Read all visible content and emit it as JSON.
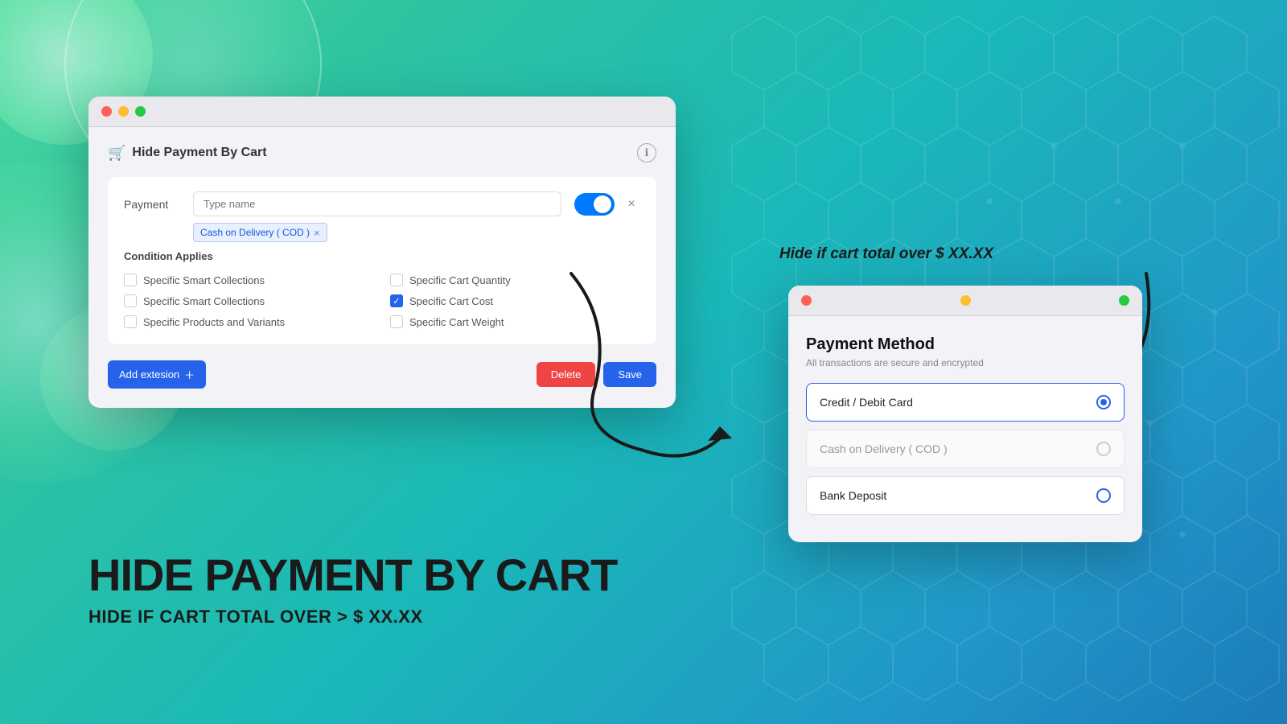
{
  "background": {
    "gradient_start": "#4dd9a0",
    "gradient_end": "#1a7bb8"
  },
  "admin_window": {
    "title": "Hide Payment By Cart",
    "info_icon": "ℹ",
    "traffic_lights": [
      "red",
      "yellow",
      "green"
    ],
    "payment_label": "Payment",
    "payment_placeholder": "Type name",
    "tag_label": "Cash on Delivery ( COD )",
    "tag_remove": "×",
    "toggle_on": true,
    "close_label": "×",
    "condition_title": "Condition Applies",
    "conditions": [
      {
        "label": "Specific Smart Collections",
        "checked": false,
        "col": 1
      },
      {
        "label": "Specific Cart Quantity",
        "checked": false,
        "col": 2
      },
      {
        "label": "Specific Smart Collections",
        "checked": false,
        "col": 1
      },
      {
        "label": "Specific Cart Cost",
        "checked": true,
        "col": 2
      },
      {
        "label": "Specific Products and Variants",
        "checked": false,
        "col": 1
      },
      {
        "label": "Specific Cart Weight",
        "checked": false,
        "col": 2
      }
    ],
    "add_extension_label": "Add extesion",
    "delete_label": "Delete",
    "save_label": "Save"
  },
  "payment_window": {
    "title_annotation": "Hide if cart total over $ XX.XX",
    "heading": "Payment Method",
    "subtitle": "All transactions are secure and encrypted",
    "options": [
      {
        "label": "Credit / Debit Card",
        "selected": true,
        "disabled": false
      },
      {
        "label": "Cash on Delivery ( COD )",
        "selected": false,
        "disabled": true
      },
      {
        "label": "Bank Deposit",
        "selected": false,
        "disabled": false
      }
    ]
  },
  "bottom_text": {
    "main_heading": "HIDE PAYMENT BY CART",
    "sub_heading": "HIDE IF CART TOTAL OVER > $ XX.XX"
  }
}
